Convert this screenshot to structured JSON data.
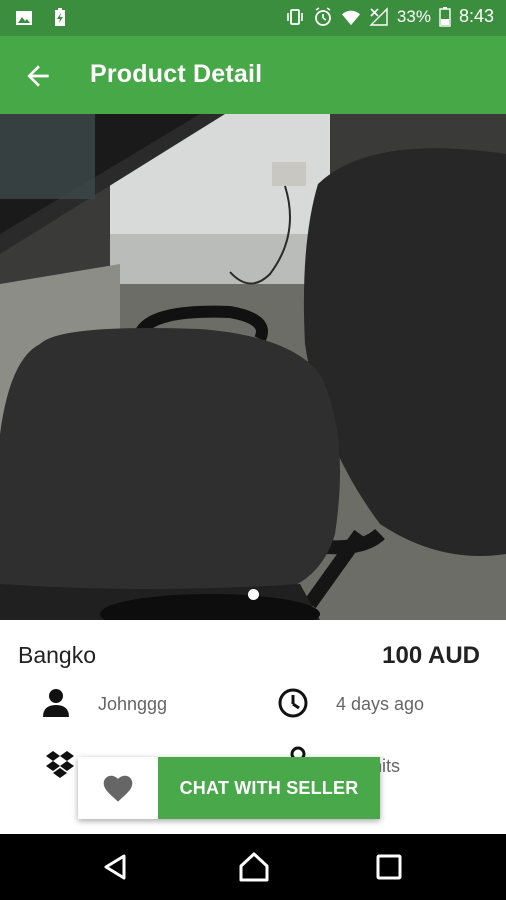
{
  "status_bar": {
    "battery": "33%",
    "time": "8:43"
  },
  "app_bar": {
    "title": "Product Detail"
  },
  "product": {
    "name": "Bangko",
    "price": "100 AUD",
    "seller": "Johnggg",
    "posted": "4 days ago",
    "quantity_suffix": "nits"
  },
  "actions": {
    "chat_label": "CHAT WITH SELLER"
  },
  "colors": {
    "status_bar": "#3b8e3d",
    "app_bar": "#47a847",
    "chat_button": "#48a84a"
  }
}
